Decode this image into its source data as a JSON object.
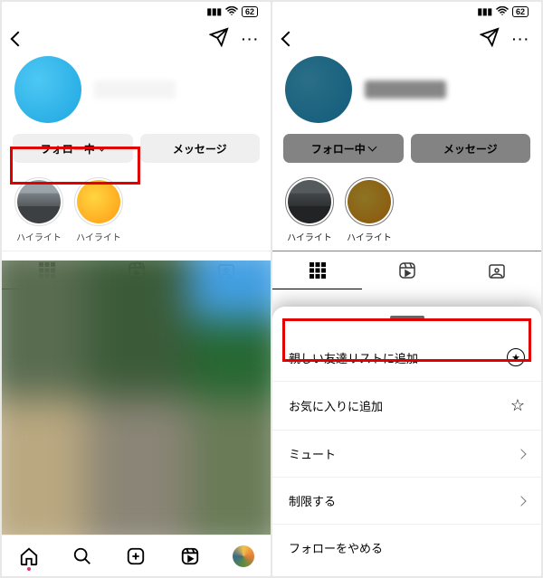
{
  "status": {
    "battery": "62"
  },
  "buttons": {
    "following": "フォロー中",
    "message": "メッセージ"
  },
  "highlights": [
    {
      "label": "ハイライト"
    },
    {
      "label": "ハイライト"
    }
  ],
  "sheet": {
    "add_close_friends": "親しい友達リストに追加",
    "add_favorites": "お気に入りに追加",
    "mute": "ミュート",
    "restrict": "制限する",
    "unfollow": "フォローをやめる"
  }
}
